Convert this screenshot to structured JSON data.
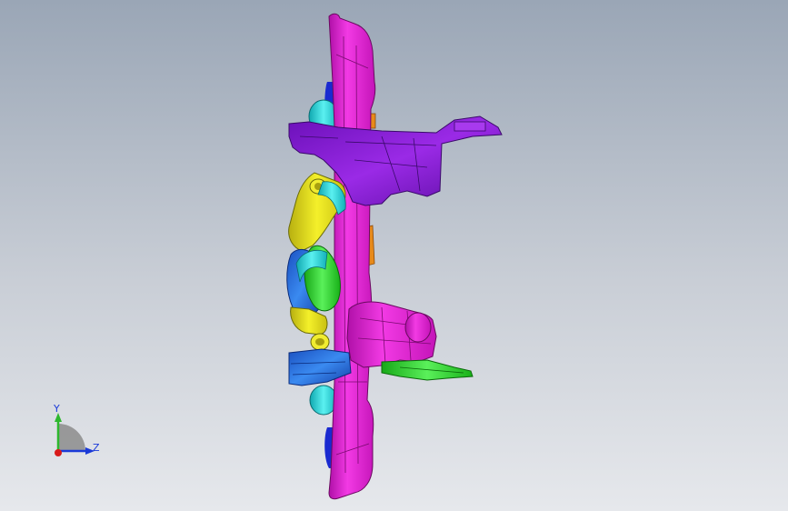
{
  "viewport": {
    "background_top": "#9aa6b6",
    "background_bottom": "#e6e8ec"
  },
  "model": {
    "colors": {
      "magenta": "#e81ad8",
      "purple": "#8a1ad6",
      "yellow": "#e8e41a",
      "cyan": "#22d8dc",
      "blue": "#1a6ae0",
      "green": "#2ed82e",
      "orange": "#e88a1a",
      "navy": "#1a2ad0"
    }
  },
  "triad": {
    "y_label": "Y",
    "z_label": "Z",
    "y_color": "#2db82d",
    "z_color": "#1a3ad8",
    "origin_color": "#d81a1a",
    "label_color": "#1a3ad8"
  }
}
